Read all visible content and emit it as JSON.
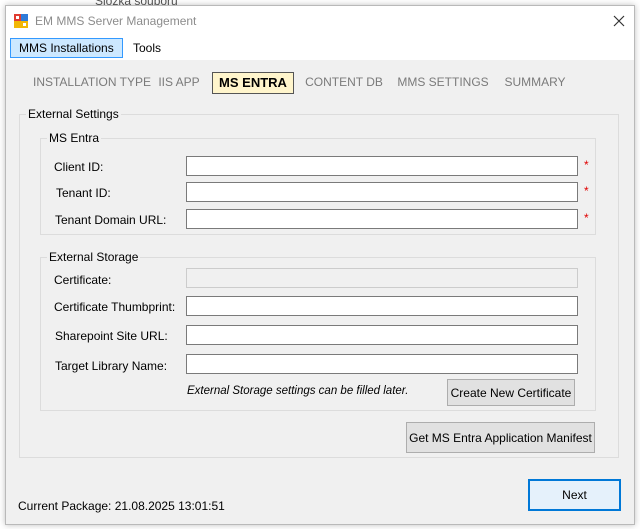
{
  "background_text": "Složka souborů",
  "window": {
    "title": "EM MMS Server Management"
  },
  "menu": [
    {
      "label": "MMS Installations",
      "active": true
    },
    {
      "label": "Tools",
      "active": false
    }
  ],
  "tabs": [
    {
      "label": "INSTALLATION TYPE",
      "active": false
    },
    {
      "label": "IIS APP",
      "active": false
    },
    {
      "label": "MS ENTRA",
      "active": true
    },
    {
      "label": "CONTENT DB",
      "active": false
    },
    {
      "label": "MMS SETTINGS",
      "active": false
    },
    {
      "label": "SUMMARY",
      "active": false
    }
  ],
  "external_settings": {
    "title": "External Settings",
    "ms_entra": {
      "title": "MS Entra",
      "fields": [
        {
          "label": "Client ID:",
          "value": "",
          "required": true
        },
        {
          "label": "Tenant ID:",
          "value": "",
          "required": true
        },
        {
          "label": "Tenant Domain URL:",
          "value": "",
          "required": true
        }
      ],
      "required_mark": "*"
    },
    "external_storage": {
      "title": "External Storage",
      "fields": [
        {
          "label": "Certificate:",
          "value": "",
          "disabled": true
        },
        {
          "label": "Certificate Thumbprint:",
          "value": "",
          "disabled": false
        },
        {
          "label": "Sharepoint Site URL:",
          "value": "",
          "disabled": false
        },
        {
          "label": "Target Library Name:",
          "value": "",
          "disabled": false
        }
      ],
      "note": "External Storage settings can be filled later.",
      "create_certificate_label": "Create New Certificate"
    },
    "get_manifest_label": "Get MS Entra Application Manifest"
  },
  "status": {
    "current_package": "Current Package: 21.08.2025 13:01:51"
  },
  "next_label": "Next",
  "colors": {
    "accent": "#0078d7",
    "active_tab_bg": "#fff5cc",
    "menu_highlight": "#cce8ff",
    "required": "#e00000"
  }
}
